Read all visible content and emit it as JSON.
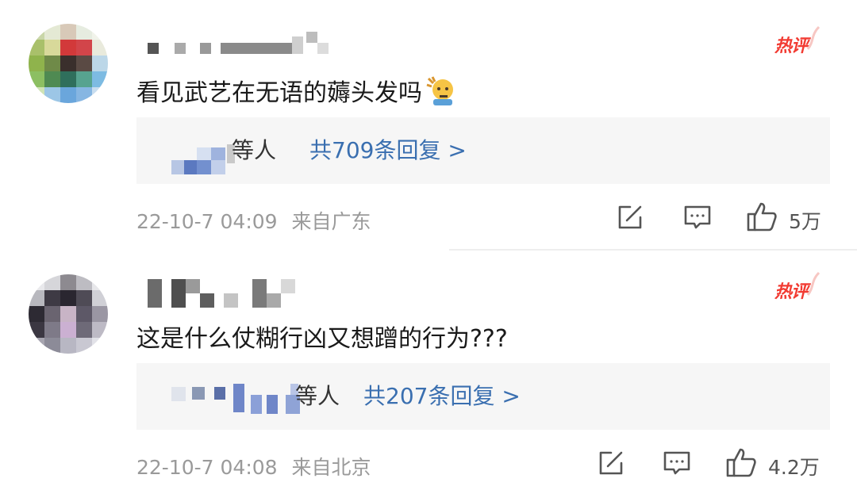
{
  "comments": [
    {
      "badge": "热评",
      "text": "看见武艺在无语的薅头发吗",
      "emoji_icon": "grabbing-hair-emoji-icon",
      "reply_names": "等人",
      "reply_link": "共709条回复 >",
      "time": "22-10-7 04:09",
      "location": "来自广东",
      "like_count": "5万"
    },
    {
      "badge": "热评",
      "text": "这是什么仗糊行凶又想蹭的行为???",
      "reply_names": "等人",
      "reply_link": "共207条回复 >",
      "time": "22-10-7 04:08",
      "location": "来自北京",
      "like_count": "4.2万"
    }
  ],
  "colors": {
    "badge": "#f23b32",
    "reply_link": "#3a6fb0",
    "reply_bg": "#f6f6f6",
    "meta": "#9a9a9a"
  }
}
